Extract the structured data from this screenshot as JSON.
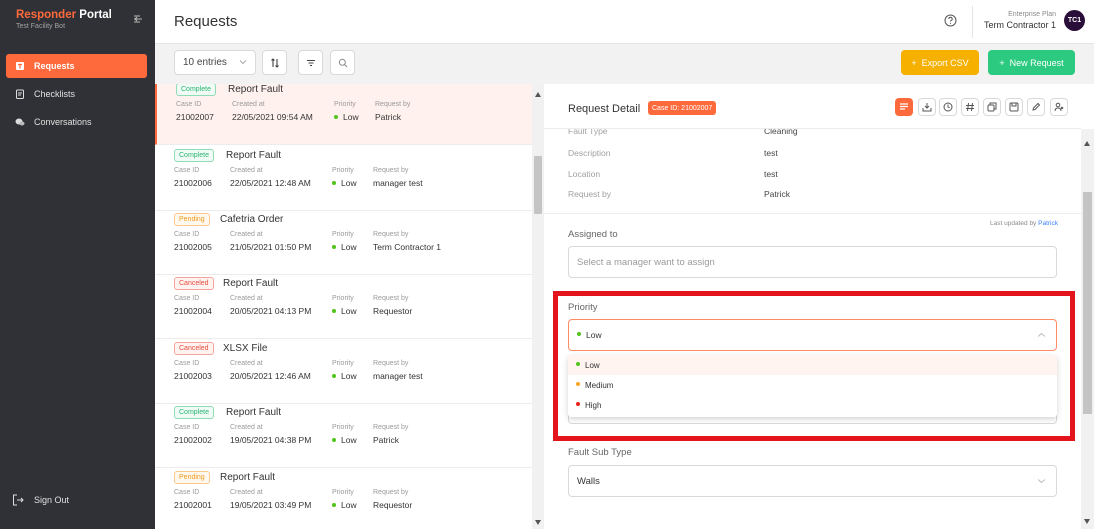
{
  "sidebar": {
    "brand_part1": "Responder",
    "brand_part2": "Portal",
    "subtitle": "Test Facility Bot",
    "items": [
      {
        "label": "Requests",
        "icon": "request-icon",
        "active": true
      },
      {
        "label": "Checklists",
        "icon": "checklist-icon",
        "active": false
      },
      {
        "label": "Conversations",
        "icon": "chat-icon",
        "active": false
      }
    ],
    "signout_label": "Sign Out"
  },
  "header": {
    "title": "Requests",
    "plan": "Enterprise Plan",
    "user": "Term Contractor 1",
    "avatar": "TC1"
  },
  "toolbar": {
    "entries": "10 entries",
    "export_label": "Export CSV",
    "new_label": "New Request"
  },
  "list_labels": {
    "case_id": "Case ID",
    "created_at": "Created at",
    "priority": "Priority",
    "request_by": "Request by"
  },
  "requests": [
    {
      "status": "Complete",
      "status_class": "complete",
      "title": "Report Fault",
      "case_id": "21002007",
      "created": "22/05/2021 09:54 AM",
      "priority": "Low",
      "by": "Patrick"
    },
    {
      "status": "Complete",
      "status_class": "complete",
      "title": "Report Fault",
      "case_id": "21002006",
      "created": "22/05/2021 12:48 AM",
      "priority": "Low",
      "by": "manager test"
    },
    {
      "status": "Pending",
      "status_class": "pending",
      "title": "Cafetria Order",
      "case_id": "21002005",
      "created": "21/05/2021 01:50 PM",
      "priority": "Low",
      "by": "Term Contractor 1"
    },
    {
      "status": "Canceled",
      "status_class": "canceled",
      "title": "Report Fault",
      "case_id": "21002004",
      "created": "20/05/2021 04:13 PM",
      "priority": "Low",
      "by": "Requestor"
    },
    {
      "status": "Canceled",
      "status_class": "canceled",
      "title": "XLSX File",
      "case_id": "21002003",
      "created": "20/05/2021 12:46 AM",
      "priority": "Low",
      "by": "manager test"
    },
    {
      "status": "Complete",
      "status_class": "complete",
      "title": "Report Fault",
      "case_id": "21002002",
      "created": "19/05/2021 04:38 PM",
      "priority": "Low",
      "by": "Patrick"
    },
    {
      "status": "Pending",
      "status_class": "pending",
      "title": "Report Fault",
      "case_id": "21002001",
      "created": "19/05/2021 03:49 PM",
      "priority": "Low",
      "by": "Requestor"
    }
  ],
  "detail": {
    "title": "Request Detail",
    "case_badge": "Case ID: 21002007",
    "fields": [
      {
        "label": "Fault Type",
        "value": "Cleaning"
      },
      {
        "label": "Description",
        "value": "test"
      },
      {
        "label": "Location",
        "value": "test"
      },
      {
        "label": "Request by",
        "value": "Patrick"
      }
    ],
    "last_updated_prefix": "Last updated by",
    "last_updated_by": "Patrick",
    "assigned_label": "Assigned to",
    "assigned_placeholder": "Select a manager want to assign",
    "priority_label": "Priority",
    "priority_value": "Low",
    "priority_options": [
      {
        "label": "Low",
        "color": "#52c41a"
      },
      {
        "label": "Medium",
        "color": "#f5a623"
      },
      {
        "label": "High",
        "color": "#e8211a"
      }
    ],
    "fault_sub_type_label": "Fault Sub Type",
    "fault_sub_type_value": "Walls"
  },
  "colors": {
    "accent": "#ff6a3d",
    "sidebar_bg": "#2f3136",
    "export": "#f5b000",
    "new": "#2bca80",
    "highlight": "#e3141c",
    "priority_low": "#52c41a"
  }
}
